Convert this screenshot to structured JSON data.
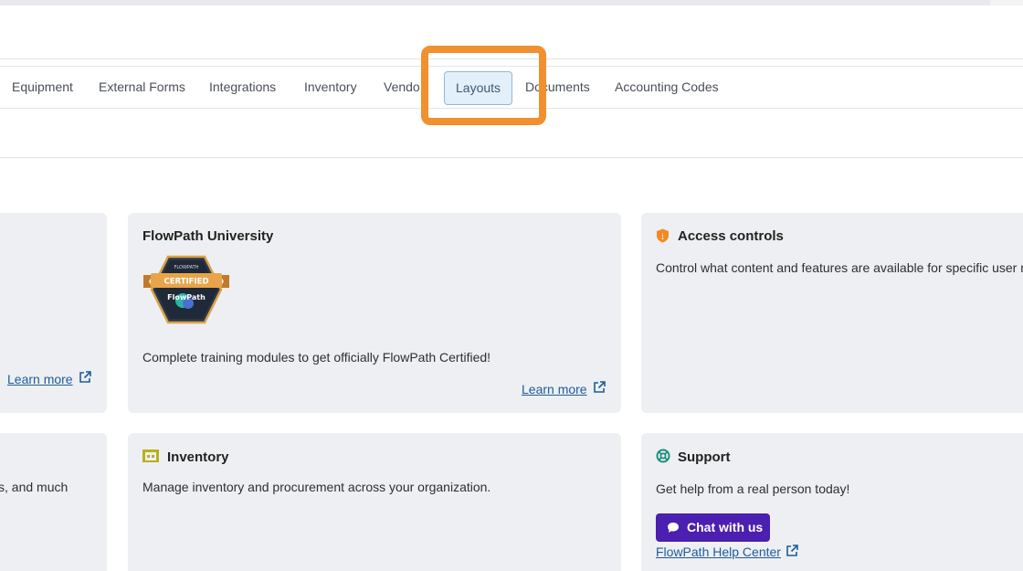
{
  "nav": {
    "items": [
      {
        "label": "Equipment"
      },
      {
        "label": "External Forms"
      },
      {
        "label": "Integrations"
      },
      {
        "label": "Inventory"
      },
      {
        "label": "Vendo"
      },
      {
        "label": "Layouts",
        "active": true
      },
      {
        "label": "Documents"
      },
      {
        "label": "Accounting Codes"
      }
    ]
  },
  "cards": {
    "left_top": {
      "link": "Learn more"
    },
    "university": {
      "title": "FlowPath University",
      "badge_top": "FLOWPATH",
      "badge_ribbon": "CERTIFIED",
      "badge_name": "FlowPath",
      "text": "Complete training modules to get officially FlowPath Certified!",
      "link": "Learn more"
    },
    "access": {
      "title": "Access controls",
      "text": "Control what content and features are available for specific user r"
    },
    "left_bottom": {
      "text": "s, and much"
    },
    "inventory": {
      "title": "Inventory",
      "text": "Manage inventory and procurement across your organization."
    },
    "support": {
      "title": "Support",
      "text": "Get help from a real person today!",
      "button": "Chat with us",
      "link": "FlowPath Help Center"
    }
  },
  "colors": {
    "highlight": "#f0902f",
    "link": "#1c5d9b",
    "chat_button": "#4b1fb0",
    "card_bg": "#eeeff2",
    "shield_icon": "#f08a24"
  }
}
